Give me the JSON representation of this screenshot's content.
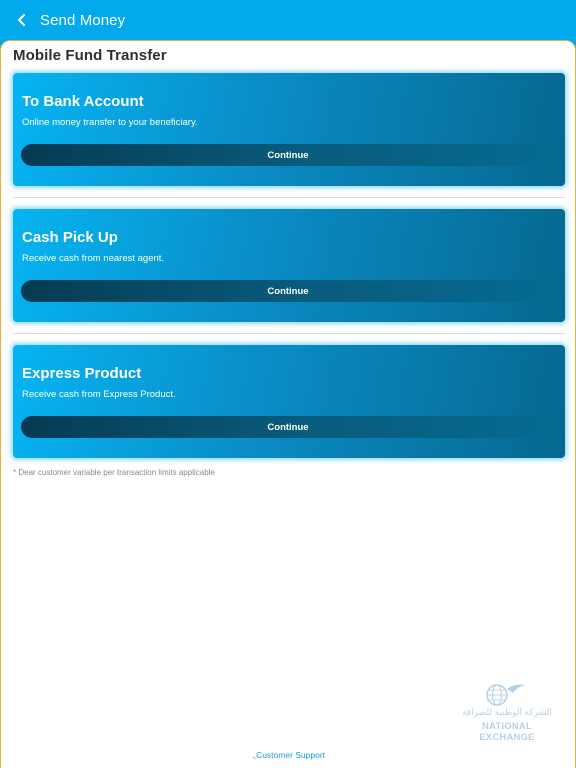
{
  "header": {
    "title": "Send Money",
    "back_icon": "chevron-left-icon"
  },
  "section": {
    "title": "Mobile Fund Transfer"
  },
  "cards": [
    {
      "title": "To Bank Account",
      "subtitle": "Online money transfer to your beneficiary.",
      "button": "Continue"
    },
    {
      "title": "Cash Pick Up",
      "subtitle": "Receive cash from nearest agent.",
      "button": "Continue"
    },
    {
      "title": "Express Product",
      "subtitle": "Receive cash from Express Product.",
      "button": "Continue"
    }
  ],
  "note": "* Dear customer variable per transaction limits applicable",
  "logo": {
    "arabic": "الشركة الوطنية للصرافة",
    "english": "NATIONAL EXCHANGE",
    "icon": "globe-bird-logo"
  },
  "footer": {
    "support_label": "Customer Support"
  },
  "colors": {
    "header": "#02aaec",
    "card_start": "#06b4f2",
    "card_end": "#06688f",
    "button": "#063b52",
    "border": "#e6b23a"
  }
}
